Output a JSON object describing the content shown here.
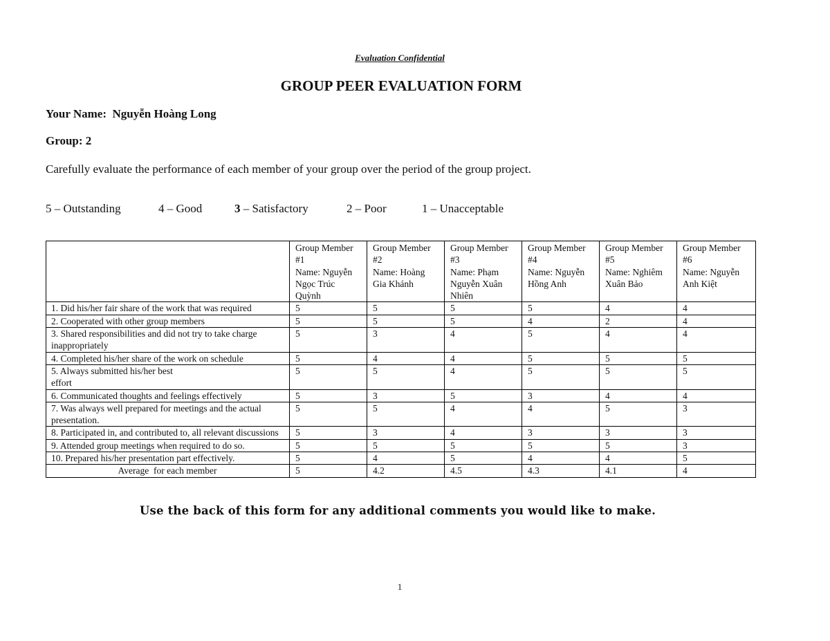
{
  "header": {
    "confidential_label": "Evaluation Confidential",
    "title": "GROUP PEER EVALUATION FORM"
  },
  "evaluator": {
    "name_label": "Your Name:",
    "name_value": "Nguyễn Hoàng Long",
    "group_label": "Group:",
    "group_value": "2"
  },
  "instructions": "Carefully evaluate the performance of each member of your group over the period of the group project.",
  "rating_scale": [
    {
      "score": "5",
      "label": "Outstanding"
    },
    {
      "score": "4",
      "label": "Good"
    },
    {
      "score": "3",
      "label": "Satisfactory"
    },
    {
      "score": "2",
      "label": "Poor"
    },
    {
      "score": "1",
      "label": "Unacceptable"
    }
  ],
  "scale_separator": " – ",
  "table": {
    "members": [
      {
        "heading": "Group Member",
        "number": "#1",
        "name_label": "Name:",
        "name": "Nguyễn Ngọc Trúc Quỳnh"
      },
      {
        "heading": "Group Member",
        "number": "#2",
        "name_label": "Name:",
        "name": "Hoàng Gia Khánh"
      },
      {
        "heading": "Group Member",
        "number": "#3",
        "name_label": "Name:",
        "name": "Phạm Nguyễn Xuân Nhiên"
      },
      {
        "heading": "Group Member",
        "number": "#4",
        "name_label": "Name:",
        "name": "Nguyễn Hồng Anh"
      },
      {
        "heading": "Group Member",
        "number": "#5",
        "name_label": "Name:",
        "name": "Nghiêm Xuân Bảo"
      },
      {
        "heading": "Group Member",
        "number": "#6",
        "name_label": "Name:",
        "name": "Nguyễn Anh Kiệt"
      }
    ],
    "criteria": [
      {
        "label": "1. Did his/her fair share of the work that was required",
        "scores": [
          "5",
          "5",
          "5",
          "5",
          "4",
          "4"
        ]
      },
      {
        "label": "2. Cooperated with other group members",
        "scores": [
          "5",
          "5",
          "5",
          "4",
          "2",
          "4"
        ]
      },
      {
        "label": "3. Shared responsibilities and did not try to take charge inappropriately",
        "scores": [
          "5",
          "3",
          "4",
          "5",
          "4",
          "4"
        ]
      },
      {
        "label": "4. Completed his/her share of the work on schedule",
        "scores": [
          "5",
          "4",
          "4",
          "5",
          "5",
          "5"
        ]
      },
      {
        "label": "5. Always submitted his/her best\neffort",
        "scores": [
          "5",
          "5",
          "4",
          "5",
          "5",
          "5"
        ]
      },
      {
        "label": "6. Communicated thoughts and feelings effectively",
        "scores": [
          "5",
          "3",
          "5",
          "3",
          "4",
          "4"
        ]
      },
      {
        "label": "7. Was always well prepared for meetings and the actual presentation.",
        "scores": [
          "5",
          "5",
          "4",
          "4",
          "5",
          "3"
        ]
      },
      {
        "label": "8. Participated in, and contributed to, all relevant discussions",
        "scores": [
          "5",
          "3",
          "4",
          "3",
          "3",
          "3"
        ]
      },
      {
        "label": "9. Attended group meetings when required to do so.",
        "scores": [
          "5",
          "5",
          "5",
          "5",
          "5",
          "3"
        ]
      },
      {
        "label": "10. Prepared his/her presentation part effectively.",
        "scores": [
          "5",
          "4",
          "5",
          "4",
          "4",
          "5"
        ]
      }
    ],
    "average": {
      "label": "Average  for each member",
      "scores": [
        "5",
        "4.2",
        "4.5",
        "4.3",
        "4.1",
        "4"
      ]
    }
  },
  "footer_note": "Use the back of this form for any additional comments you would like to make.",
  "page_number": "1"
}
